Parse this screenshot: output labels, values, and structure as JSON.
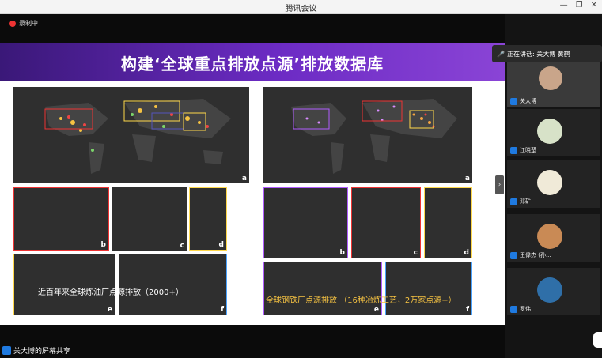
{
  "window": {
    "title": "腾讯会议"
  },
  "recording": {
    "label": "录制中"
  },
  "slide": {
    "title": "构建‘全球重点排放点源’排放数据库",
    "left_caption": "近百年来全球炼油厂点源排放（2000+）",
    "right_caption": "全球钢铁厂点源排放 （16种冶炼工艺，2万家点源+）",
    "left_maps": [
      "a",
      "b",
      "c",
      "d",
      "e",
      "f"
    ],
    "right_maps": [
      "a",
      "b",
      "c",
      "d",
      "e",
      "f"
    ]
  },
  "share_bar": {
    "label": "关大博的屏幕共享"
  },
  "participants_panel": {
    "speaking_label": "正在讲话: 关大博 黄鹤",
    "participants": [
      {
        "name": "关大博"
      },
      {
        "name": "江晓楚"
      },
      {
        "name": "邓矿"
      },
      {
        "name": "王偉杰 (孙..."
      },
      {
        "name": "罗伟"
      }
    ]
  },
  "colors": {
    "banner": "#6c2bc4",
    "accent": "#1f7ae0"
  }
}
